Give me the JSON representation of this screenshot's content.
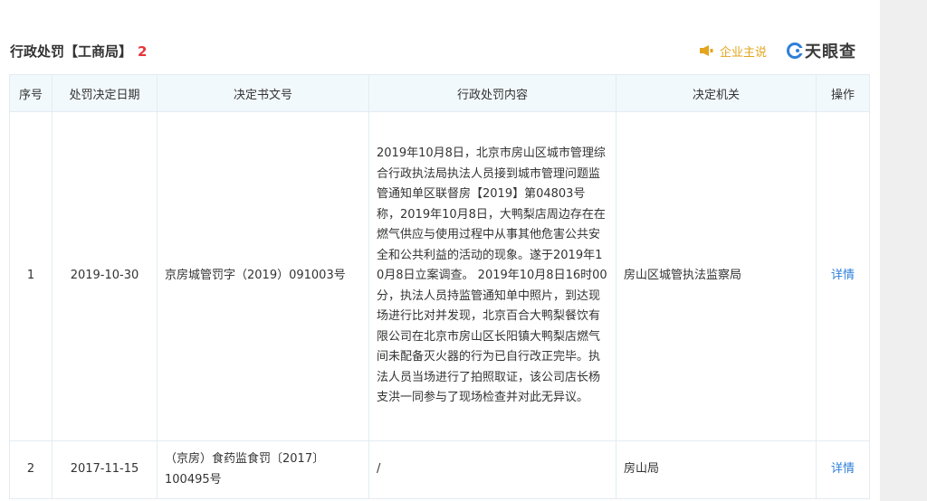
{
  "section": {
    "title": "行政处罚【工商局】",
    "count": "2"
  },
  "header_actions": {
    "promo_label": "企业主说",
    "brand_label": "天眼查"
  },
  "colors": {
    "accent_count": "#e6353a",
    "promo": "#e3a41e",
    "link": "#2f7fd8",
    "header_bg": "#f2f9fc",
    "border": "#e3ecf2"
  },
  "table": {
    "columns": [
      "序号",
      "处罚决定日期",
      "决定书文号",
      "行政处罚内容",
      "决定机关",
      "操作"
    ],
    "rows": [
      {
        "index": "1",
        "date": "2019-10-30",
        "doc_no": "京房城管罚字（2019）091003号",
        "content": "2019年10月8日，北京市房山区城市管理综合行政执法局执法人员接到城市管理问题监管通知单区联督房【2019】第04803号称，2019年10月8日，大鸭梨店周边存在在燃气供应与使用过程中从事其他危害公共安全和公共利益的活动的现象。遂于2019年10月8日立案调查。 2019年10月8日16时00分，执法人员持监管通知单中照片，到达现场进行比对并发现，北京百合大鸭梨餐饮有限公司在北京市房山区长阳镇大鸭梨店燃气间未配备灭火器的行为已自行改正完毕。执法人员当场进行了拍照取证，该公司店长杨支洪一同参与了现场检查并对此无异议。",
        "authority": "房山区城管执法监察局",
        "action": "详情"
      },
      {
        "index": "2",
        "date": "2017-11-15",
        "doc_no": "（京房）食药监食罚〔2017〕100495号",
        "content": "/",
        "authority": "房山局",
        "action": "详情"
      }
    ]
  }
}
